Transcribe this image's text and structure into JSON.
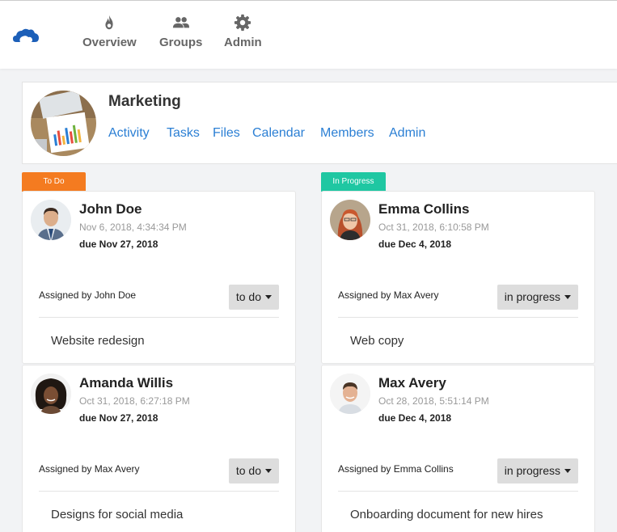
{
  "nav": {
    "items": [
      {
        "label": "Overview",
        "icon": "flame-icon"
      },
      {
        "label": "Groups",
        "icon": "people-icon"
      },
      {
        "label": "Admin",
        "icon": "gear-icon"
      }
    ]
  },
  "group": {
    "title": "Marketing",
    "tabs": [
      "Activity",
      "Tasks",
      "Files",
      "Calendar",
      "Members",
      "Admin"
    ]
  },
  "columns": [
    {
      "label": "To Do",
      "color": "#f47b20"
    },
    {
      "label": "In Progress",
      "color": "#1fc7a2"
    }
  ],
  "cards": [
    {
      "name": "John Doe",
      "date": "Nov 6, 2018, 4:34:34 PM",
      "due": "due Nov 27, 2018",
      "assigned": "Assigned by John Doe",
      "status": "to do",
      "task": "Website redesign"
    },
    {
      "name": "Emma Collins",
      "date": "Oct 31, 2018, 6:10:58 PM",
      "due": "due Dec 4, 2018",
      "assigned": "Assigned by Max Avery",
      "status": "in progress",
      "task": "Web copy"
    },
    {
      "name": "Amanda Willis",
      "date": "Oct 31, 2018, 6:27:18 PM",
      "due": "due Nov 27, 2018",
      "assigned": "Assigned by Max Avery",
      "status": "to do",
      "task": "Designs for social media"
    },
    {
      "name": "Max Avery",
      "date": "Oct 28, 2018, 5:51:14 PM",
      "due": "due Dec 4, 2018",
      "assigned": "Assigned by Emma Collins",
      "status": "in progress",
      "task": "Onboarding document for new hires"
    }
  ]
}
